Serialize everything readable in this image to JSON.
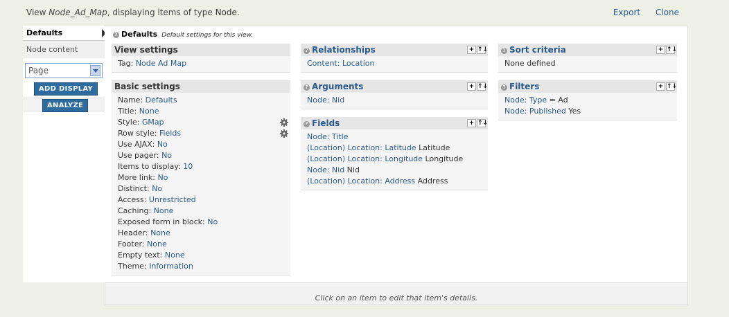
{
  "header": {
    "prefix": "View ",
    "view_name": "Node_Ad_Map",
    "middle": ", displaying items of type ",
    "item_type": "Node",
    "suffix": ".",
    "export_label": "Export",
    "clone_label": "Clone"
  },
  "left": {
    "tab_defaults": "Defaults",
    "tab_node_content": "Node content",
    "display_select_value": "Page",
    "add_display_label": "ADD DISPLAY",
    "analyze_label": "ANALYZE"
  },
  "main": {
    "defaults_title": "Defaults",
    "defaults_desc": "Default settings for this view."
  },
  "view_settings": {
    "title": "View settings",
    "tag_label": "Tag: ",
    "tag_value": "Node Ad Map"
  },
  "basic_settings": {
    "title": "Basic settings",
    "rows": [
      {
        "label": "Name: ",
        "value": "Defaults"
      },
      {
        "label": "Title: ",
        "value": "None"
      },
      {
        "label": "Style: ",
        "value": "GMap"
      },
      {
        "label": "Row style: ",
        "value": "Fields"
      },
      {
        "label": "Use AJAX: ",
        "value": "No"
      },
      {
        "label": "Use pager: ",
        "value": "No"
      },
      {
        "label": "Items to display: ",
        "value": "10"
      },
      {
        "label": "More link: ",
        "value": "No"
      },
      {
        "label": "Distinct: ",
        "value": "No"
      },
      {
        "label": "Access: ",
        "value": "Unrestricted"
      },
      {
        "label": "Caching: ",
        "value": "None"
      },
      {
        "label": "Exposed form in block: ",
        "value": "No"
      },
      {
        "label": "Header: ",
        "value": "None"
      },
      {
        "label": "Footer: ",
        "value": "None"
      },
      {
        "label": "Empty text: ",
        "value": "None"
      },
      {
        "label": "Theme: ",
        "value": "Information"
      }
    ]
  },
  "relationships": {
    "title": "Relationships",
    "rows": [
      {
        "link": "Content: Location",
        "text": ""
      }
    ]
  },
  "arguments": {
    "title": "Arguments",
    "rows": [
      {
        "link": "Node: Nid",
        "text": ""
      }
    ]
  },
  "fields": {
    "title": "Fields",
    "rows": [
      {
        "link": "Node: Title",
        "text": ""
      },
      {
        "link": "(Location) Location: Latitude",
        "text": " Latitude"
      },
      {
        "link": "(Location) Location: Longitude",
        "text": " Longitude"
      },
      {
        "link": "Node: Nid",
        "text": " Nid"
      },
      {
        "link": "(Location) Location: Address",
        "text": " Address"
      }
    ]
  },
  "sort_criteria": {
    "title": "Sort criteria",
    "rows": [
      {
        "link": "",
        "text": "None defined"
      }
    ]
  },
  "filters": {
    "title": "Filters",
    "rows": [
      {
        "link": "Node: Type",
        "text": " = Ad"
      },
      {
        "link": "Node: Published",
        "text": " Yes"
      }
    ]
  },
  "footer": {
    "hint": "Click on an item to edit that item's details."
  },
  "ops": {
    "add": "+",
    "rearrange": "↑↓"
  },
  "help_glyph": "?"
}
